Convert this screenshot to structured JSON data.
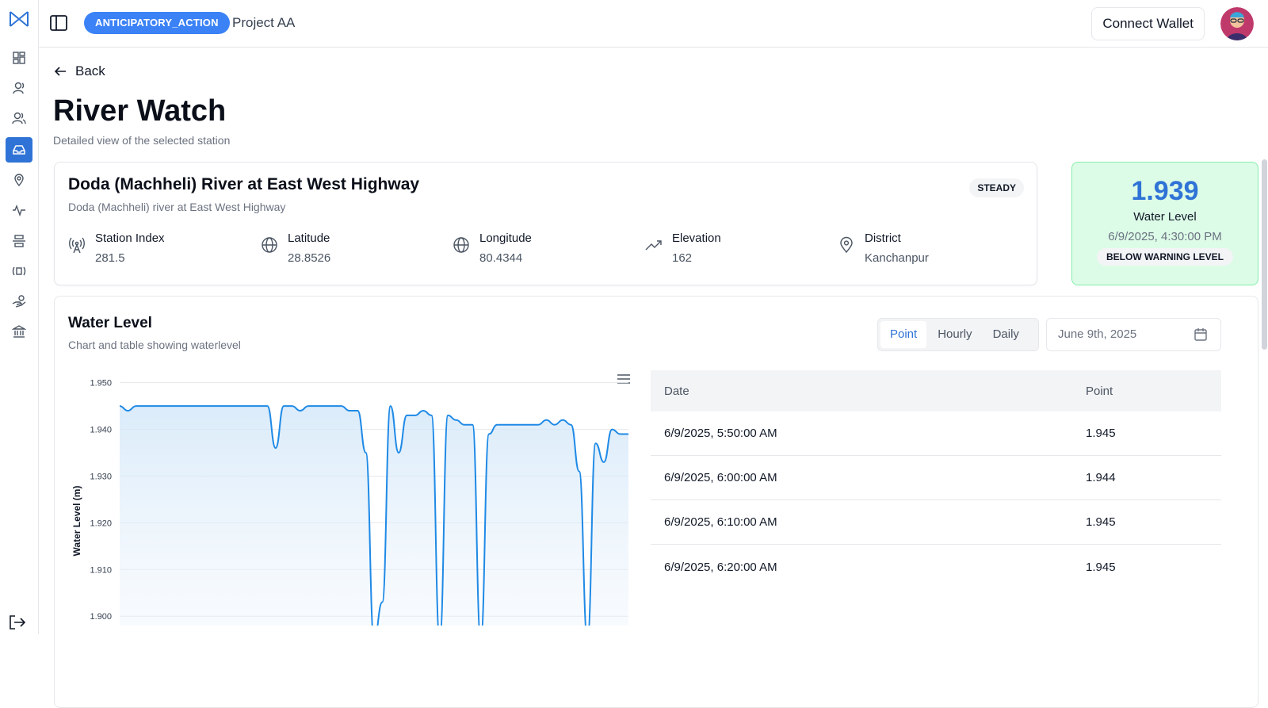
{
  "colors": {
    "accent": "#2f73d6",
    "badge": "#3b82f6",
    "wl_card_bg": "#dcfce7",
    "line": "#1f8ae6"
  },
  "sidebar": {
    "icons": [
      "layout-grid-icon",
      "user-icon",
      "users-icon",
      "inbox-icon",
      "map-pin-icon",
      "activity-icon",
      "align-center-icon",
      "radio-icon",
      "hand-coins-icon",
      "bank-icon"
    ],
    "active_index": 3
  },
  "header": {
    "project_type": "ANTICIPATORY_ACTION",
    "project_name": "Project AA",
    "wallet_label": "Connect Wallet"
  },
  "page": {
    "back_label": "Back",
    "title": "River Watch",
    "subtitle": "Detailed view of the selected station"
  },
  "station": {
    "name": "Doda (Machheli) River at East West Highway",
    "description": "Doda (Machheli) river at East West Highway",
    "status": "STEADY",
    "fields": [
      {
        "label": "Station Index",
        "value": "281.5"
      },
      {
        "label": "Latitude",
        "value": "28.8526"
      },
      {
        "label": "Longitude",
        "value": "80.4344"
      },
      {
        "label": "Elevation",
        "value": "162"
      },
      {
        "label": "District",
        "value": "Kanchanpur"
      }
    ]
  },
  "water_level_card": {
    "value": "1.939",
    "label": "Water Level",
    "timestamp": "6/9/2025, 4:30:00 PM",
    "status": "BELOW WARNING LEVEL"
  },
  "water_level_section": {
    "title": "Water Level",
    "subtitle": "Chart and table showing waterlevel",
    "tabs": [
      "Point",
      "Hourly",
      "Daily"
    ],
    "active_tab": "Point",
    "date": "June 9th, 2025"
  },
  "chart_data": {
    "type": "area",
    "ylabel": "Water Level (m)",
    "yticks": [
      "1.950",
      "1.940",
      "1.930",
      "1.920",
      "1.910",
      "1.900"
    ],
    "ylim": [
      1.898,
      1.953
    ],
    "grid": true,
    "series": [
      {
        "values": [
          1.945,
          1.944,
          1.945,
          1.945,
          1.945,
          1.945,
          1.945,
          1.945,
          1.945,
          1.945,
          1.945,
          1.945,
          1.945,
          1.945,
          1.945,
          1.945,
          1.945,
          1.945,
          1.945,
          1.936,
          1.945,
          1.945,
          1.944,
          1.945,
          1.945,
          1.945,
          1.945,
          1.945,
          1.944,
          1.944,
          1.935,
          1.895,
          1.903,
          1.945,
          1.935,
          1.943,
          1.943,
          1.944,
          1.943,
          1.895,
          1.943,
          1.942,
          1.941,
          1.941,
          1.895,
          1.939,
          1.941,
          1.941,
          1.941,
          1.941,
          1.941,
          1.941,
          1.942,
          1.941,
          1.942,
          1.941,
          1.931,
          1.895,
          1.937,
          1.933,
          1.94,
          1.939,
          1.939
        ]
      }
    ]
  },
  "table": {
    "headers": [
      "Date",
      "Point"
    ],
    "rows": [
      [
        "6/9/2025, 5:50:00 AM",
        "1.945"
      ],
      [
        "6/9/2025, 6:00:00 AM",
        "1.944"
      ],
      [
        "6/9/2025, 6:10:00 AM",
        "1.945"
      ],
      [
        "6/9/2025, 6:20:00 AM",
        "1.945"
      ]
    ]
  }
}
